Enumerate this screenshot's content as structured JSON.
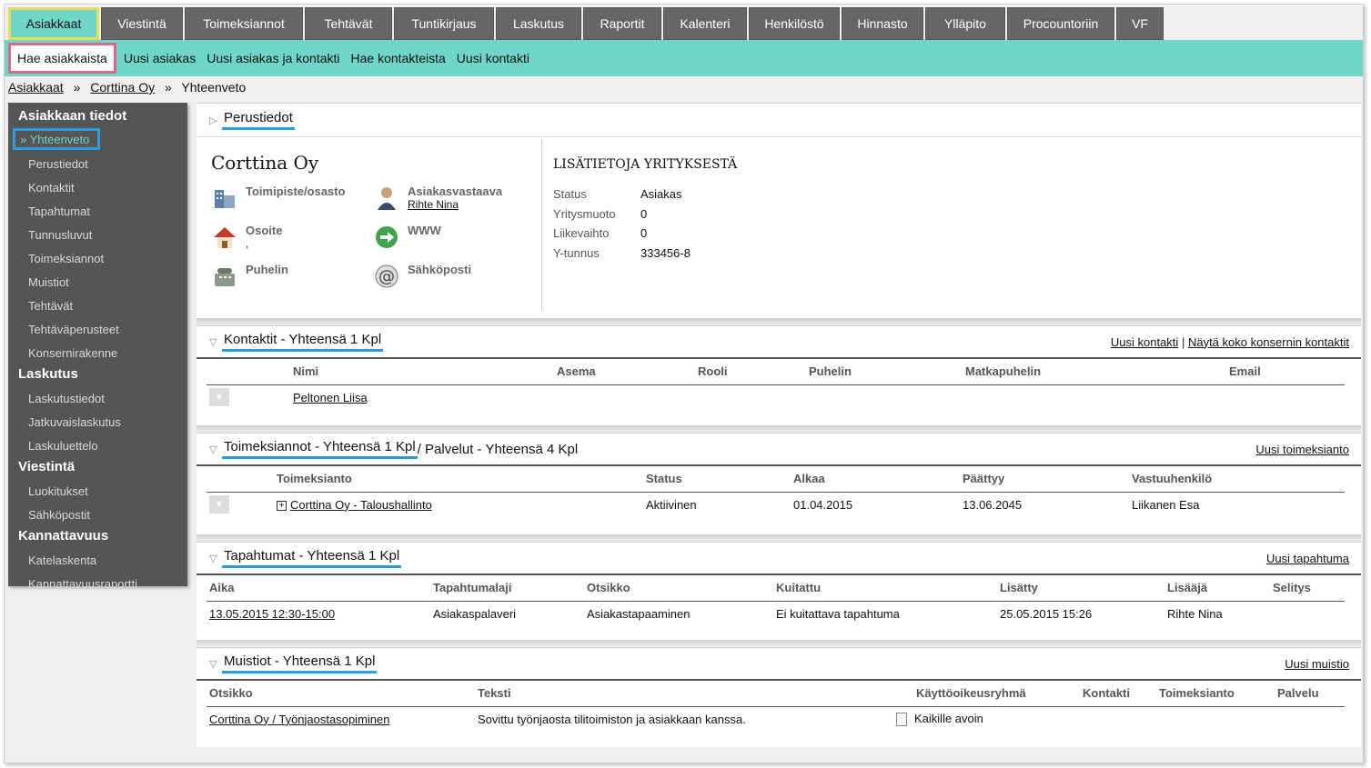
{
  "top_tabs": [
    "Asiakkaat",
    "Viestintä",
    "Toimeksiannot",
    "Tehtävät",
    "Tuntikirjaus",
    "Laskutus",
    "Raportit",
    "Kalenteri",
    "Henkilöstö",
    "Hinnasto",
    "Ylläpito",
    "Procountoriin",
    "VF"
  ],
  "sub_nav": [
    "Hae asiakkaista",
    "Uusi asiakas",
    "Uusi asiakas ja kontakti",
    "Hae kontakteista",
    "Uusi kontakti"
  ],
  "breadcrumb": {
    "root": "Asiakkaat",
    "company": "Corttina Oy",
    "current": "Yhteenveto",
    "sep": "»"
  },
  "sidebar": {
    "sections": [
      {
        "title": "Asiakkaan tiedot",
        "items": [
          "» Yhteenveto",
          "Perustiedot",
          "Kontaktit",
          "Tapahtumat",
          "Tunnusluvut",
          "Toimeksiannot",
          "Muistiot",
          "Tehtävät",
          "Tehtäväperusteet",
          "Konsernirakenne"
        ]
      },
      {
        "title": "Laskutus",
        "items": [
          "Laskutustiedot",
          "Jatkuvaislaskutus",
          "Laskuluettelo"
        ]
      },
      {
        "title": "Viestintä",
        "items": [
          "Luokitukset",
          "Sähköpostit"
        ]
      },
      {
        "title": "Kannattavuus",
        "items": [
          "Katelaskenta",
          "Kannattavuusraportti"
        ]
      }
    ]
  },
  "basic": {
    "section_title": "Perustiedot",
    "company_name": "Corttina Oy",
    "office_label": "Toimipiste/osasto",
    "manager_label": "Asiakasvastaava",
    "manager_value": "Rihte Nina",
    "address_label": "Osoite",
    "address_value": ",",
    "www_label": "WWW",
    "phone_label": "Puhelin",
    "email_label": "Sähköposti",
    "extra_title": "LISÄTIETOJA YRITYKSESTÄ",
    "extra": [
      {
        "k": "Status",
        "v": "Asiakas"
      },
      {
        "k": "Yritysmuoto",
        "v": "0"
      },
      {
        "k": "Liikevaihto",
        "v": "0"
      },
      {
        "k": "Y-tunnus",
        "v": "333456-8"
      }
    ]
  },
  "contacts": {
    "title": "Kontaktit - Yhteensä 1 Kpl",
    "link1": "Uusi kontakti",
    "link_sep": "|",
    "link2": "Näytä koko konsernin kontaktit",
    "columns": [
      "Nimi",
      "Asema",
      "Rooli",
      "Puhelin",
      "Matkapuhelin",
      "Email"
    ],
    "rows": [
      [
        "Peltonen Liisa",
        "",
        "",
        "",
        "",
        ""
      ]
    ]
  },
  "assignments": {
    "title": "Toimeksiannot - Yhteensä 1 Kpl",
    "title_suffix": " / Palvelut - Yhteensä 4 Kpl",
    "link": "Uusi toimeksianto",
    "columns": [
      "Toimeksianto",
      "Status",
      "Alkaa",
      "Päättyy",
      "Vastuuhenkilö"
    ],
    "rows": [
      [
        "Corttina Oy - Taloushallinto",
        "Aktiivinen",
        "01.04.2015",
        "13.06.2045",
        "Liikanen Esa"
      ]
    ]
  },
  "events": {
    "title": "Tapahtumat - Yhteensä 1 Kpl",
    "link": "Uusi tapahtuma",
    "columns": [
      "Aika",
      "Tapahtumalaji",
      "Otsikko",
      "Kuitattu",
      "Lisätty",
      "Lisääjä",
      "Selitys"
    ],
    "rows": [
      [
        "13.05.2015 12:30-15:00",
        "Asiakaspalaveri",
        "Asiakastapaaminen",
        "Ei kuitattava tapahtuma",
        "25.05.2015 15:26",
        "Rihte Nina",
        ""
      ]
    ]
  },
  "memos": {
    "title": "Muistiot - Yhteensä 1 Kpl",
    "link": "Uusi muistio",
    "columns": [
      "Otsikko",
      "Teksti",
      "Käyttöoikeusryhmä",
      "Kontakti",
      "Toimeksianto",
      "Palvelu"
    ],
    "rows": [
      [
        "Corttina Oy / Työnjaostasopiminen",
        "Sovittu työnjaosta tilitoimiston ja asiakkaan kanssa.",
        "Kaikille avoin",
        "",
        "",
        ""
      ]
    ]
  },
  "colors": {
    "accent": "#6ed6c9",
    "tab_gray": "#666666",
    "sidebar": "#555555",
    "highlight_blue": "#2d9be0",
    "highlight_pink": "#e0668e",
    "highlight_yellow": "#e9dd60"
  }
}
